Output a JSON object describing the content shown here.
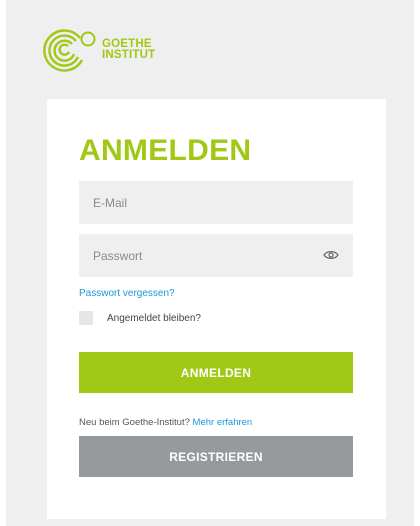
{
  "brand": {
    "line1": "GOETHE",
    "line2": "INSTITUT",
    "color": "#a0c814"
  },
  "login": {
    "title": "ANMELDEN",
    "email_placeholder": "E-Mail",
    "password_placeholder": "Passwort",
    "forgot_label": "Passwort vergessen?",
    "remember_label": "Angemeldet bleiben?",
    "remember_checked": false,
    "submit_label": "ANMELDEN",
    "new_user_text": "Neu beim Goethe-Institut?",
    "learn_more_label": "Mehr erfahren",
    "register_label": "REGISTRIEREN"
  },
  "colors": {
    "accent": "#a0c814",
    "link": "#1a9ad6",
    "register_button": "#979a9c",
    "background": "#efefef"
  },
  "icons": {
    "password_toggle": "eye-icon",
    "logo": "goethe-logo-icon"
  }
}
